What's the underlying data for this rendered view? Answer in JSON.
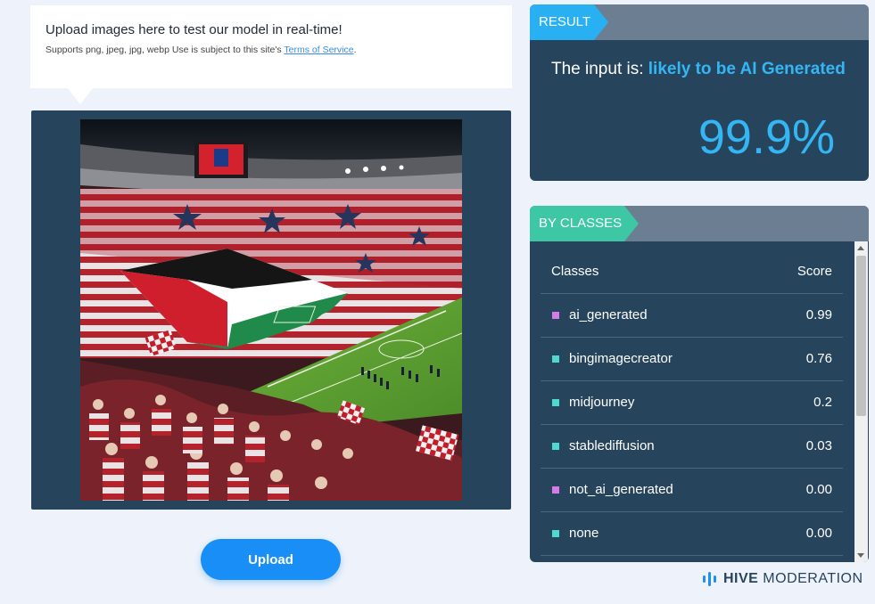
{
  "upload_info": {
    "title": "Upload images here to test our model in real-time!",
    "subtitle": "Supports png, jpeg, jpg, webp Use is subject to this site's ",
    "terms_link": "Terms of Service",
    "terms_suffix": "."
  },
  "upload_button": "Upload",
  "result": {
    "header": "RESULT",
    "prefix": "The input is: ",
    "verdict": "likely to be AI Generated",
    "score": "99.9%"
  },
  "classes": {
    "header": "BY CLASSES",
    "col_class": "Classes",
    "col_score": "Score",
    "rows": [
      {
        "name": "ai_generated",
        "score": "0.99",
        "color": "#d77be6"
      },
      {
        "name": "bingimagecreator",
        "score": "0.76",
        "color": "#4ed8d0"
      },
      {
        "name": "midjourney",
        "score": "0.2",
        "color": "#4ed8d0"
      },
      {
        "name": "stablediffusion",
        "score": "0.03",
        "color": "#4ed8d0"
      },
      {
        "name": "not_ai_generated",
        "score": "0.00",
        "color": "#d77be6"
      },
      {
        "name": "none",
        "score": "0.00",
        "color": "#4ed8d0"
      }
    ]
  },
  "logo": {
    "bold": "HIVE",
    "light": "MODERATION"
  },
  "colors": {
    "accent_blue": "#29b0f3",
    "accent_green": "#3dc7a4",
    "panel": "#27445d",
    "button": "#1a8ef7"
  }
}
